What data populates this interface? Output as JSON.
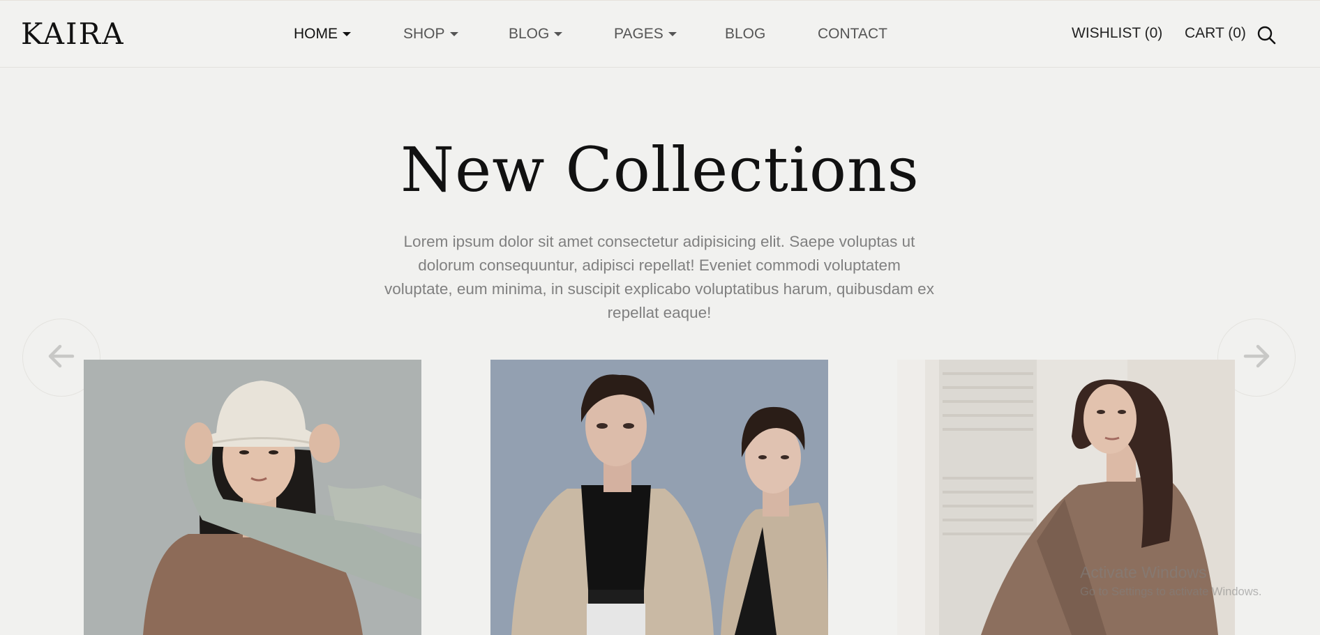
{
  "brand": {
    "logo": "KAIRA"
  },
  "nav": {
    "items": [
      {
        "label": "HOME",
        "dropdown": true,
        "active": true
      },
      {
        "label": "SHOP",
        "dropdown": true
      },
      {
        "label": "BLOG",
        "dropdown": true
      },
      {
        "label": "PAGES",
        "dropdown": true
      },
      {
        "label": "BLOG",
        "dropdown": false
      },
      {
        "label": "CONTACT",
        "dropdown": false
      }
    ]
  },
  "header_right": {
    "wishlist": "WISHLIST (0)",
    "cart": "CART (0)",
    "search_icon": "search-icon"
  },
  "hero": {
    "title": "New Collections",
    "description": "Lorem ipsum dolor sit amet consectetur adipisicing elit. Saepe voluptas ut dolorum consequuntur, adipisci repellat! Eveniet commodi voluptatem voluptate, eum minima, in suscipit explicabo voluptatibus harum, quibusdam ex repellat eaque!"
  },
  "carousel": {
    "prev_icon": "arrow-left-icon",
    "next_icon": "arrow-right-icon",
    "cards": [
      {
        "name": "product-image-1"
      },
      {
        "name": "product-image-2"
      },
      {
        "name": "product-image-3"
      }
    ]
  },
  "watermark": {
    "title": "Activate Windows",
    "subtitle": "Go to Settings to activate Windows."
  },
  "colors": {
    "background": "#f1f1ef",
    "text_dark": "#111111",
    "nav_text": "#555555",
    "body_text": "#808080",
    "arrow_gray": "#c8c8c6"
  }
}
